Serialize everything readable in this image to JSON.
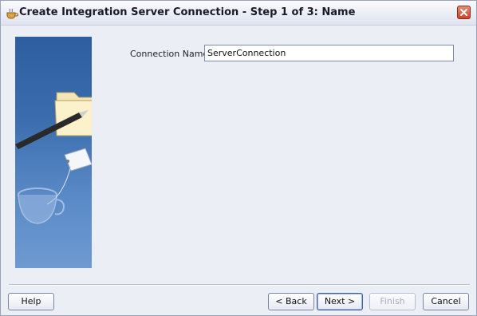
{
  "window": {
    "title": "Create Integration Server Connection - Step 1 of 3: Name"
  },
  "form": {
    "connection_name_label": "Connection Name:",
    "connection_name_value": "ServerConnection"
  },
  "buttons": {
    "help": "Help",
    "back": "< Back",
    "next": "Next >",
    "finish": "Finish",
    "cancel": "Cancel"
  },
  "icons": {
    "title": "coffee-cup-icon",
    "close": "close-icon",
    "side_illustration": "folder-pen-cup-illustration"
  },
  "colors": {
    "accent": "#3d5fa5",
    "close_button": "#c9462c",
    "side_panel": "#3b6dae"
  }
}
